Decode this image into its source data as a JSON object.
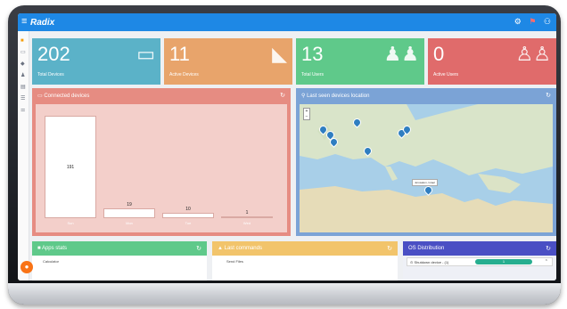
{
  "app": {
    "brand": "Radix"
  },
  "colors": {
    "topbar": "#1e88e5",
    "tile_blue": "#5bb2c8",
    "tile_orange": "#e8a46b",
    "tile_green": "#5fc98a",
    "tile_red": "#e06b6b"
  },
  "tiles": [
    {
      "value": "202",
      "label": "Total Devices",
      "icon": "device-icon"
    },
    {
      "value": "11",
      "label": "Active Devices",
      "icon": "cast-icon"
    },
    {
      "value": "13",
      "label": "Total Users",
      "icon": "users-icon"
    },
    {
      "value": "0",
      "label": "Active Users",
      "icon": "user-group-icon"
    }
  ],
  "panels": {
    "connected": {
      "title": "Connected devices",
      "refresh": "↻"
    },
    "map": {
      "title": "Last seen devices location",
      "refresh": "↻",
      "tooltip": "Jerusalem, Israel"
    },
    "apps": {
      "title": "Apps stats",
      "refresh": "↻",
      "row1": "Calculator"
    },
    "commands": {
      "title": "Last commands",
      "refresh": "↻",
      "row1": "Send Files"
    },
    "os": {
      "title": "OS Distribution",
      "refresh": "↻",
      "row1_label": "Shutdown device - (1)",
      "row1_value": "1"
    }
  },
  "chart_data": {
    "type": "bar",
    "title": "Connected devices",
    "categories": [
      "Sun",
      "Mon",
      "Tue",
      "Wed"
    ],
    "values": [
      191,
      19,
      10,
      1
    ],
    "ylim": [
      0,
      200
    ]
  }
}
